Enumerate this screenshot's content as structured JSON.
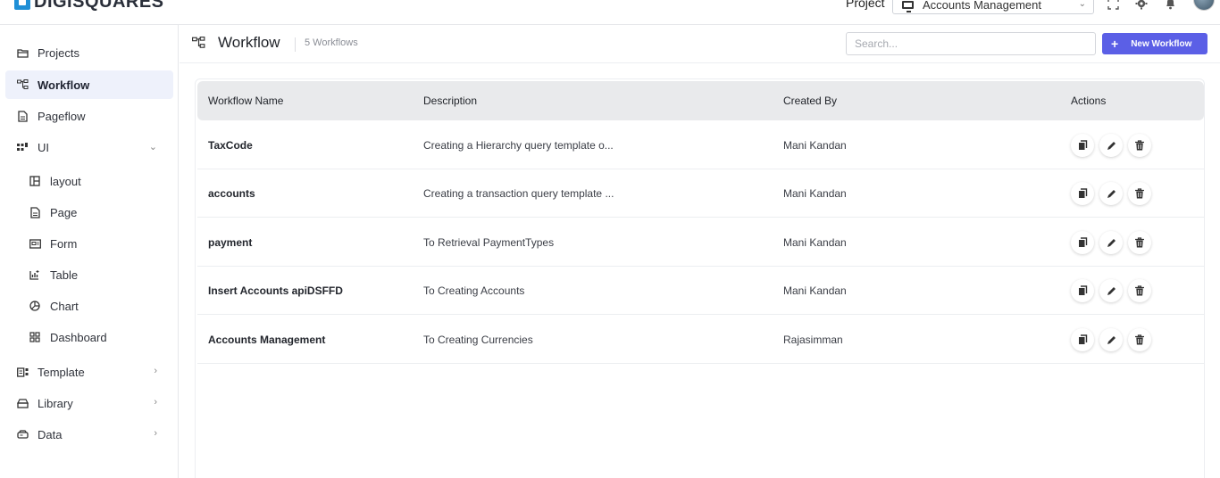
{
  "brand": {
    "name": "DIGISQUARES"
  },
  "topbar": {
    "project_label": "Project",
    "project_value": "Accounts Management"
  },
  "sidebar": {
    "items": [
      {
        "label": "Projects",
        "icon": "folder-icon"
      },
      {
        "label": "Workflow",
        "icon": "workflow-icon",
        "active": true
      },
      {
        "label": "Pageflow",
        "icon": "document-icon"
      },
      {
        "label": "UI",
        "icon": "ui-icon",
        "expanded": true
      },
      {
        "label": "layout",
        "icon": "layout-icon"
      },
      {
        "label": "Page",
        "icon": "page-icon"
      },
      {
        "label": "Form",
        "icon": "form-icon"
      },
      {
        "label": "Table",
        "icon": "table-icon"
      },
      {
        "label": "Chart",
        "icon": "chart-icon"
      },
      {
        "label": "Dashboard",
        "icon": "dashboard-icon"
      },
      {
        "label": "Template",
        "icon": "template-icon"
      },
      {
        "label": "Library",
        "icon": "library-icon"
      },
      {
        "label": "Data",
        "icon": "data-icon"
      }
    ]
  },
  "header": {
    "title": "Workflow",
    "count": "5 Workflows",
    "search_placeholder": "Search...",
    "new_button": "New Workflow"
  },
  "table": {
    "columns": [
      "Workflow Name",
      "Description",
      "Created By",
      "Actions"
    ],
    "rows": [
      {
        "name": "TaxCode",
        "description": "Creating a Hierarchy query template o...",
        "created_by": "Mani Kandan"
      },
      {
        "name": "accounts",
        "description": "Creating a transaction query template ...",
        "created_by": "Mani Kandan"
      },
      {
        "name": "payment",
        "description": "To Retrieval PaymentTypes",
        "created_by": "Mani Kandan"
      },
      {
        "name": "Insert Accounts apiDSFFD",
        "description": "To Creating Accounts",
        "created_by": "Mani Kandan"
      },
      {
        "name": "Accounts Management",
        "description": "To Creating Currencies",
        "created_by": "Rajasimman"
      }
    ]
  },
  "colors": {
    "accent": "#5b5fe6",
    "brand_blue": "#1f8fd6",
    "active_nav_bg": "#eef1fb",
    "table_header_bg": "#e9eaec"
  }
}
